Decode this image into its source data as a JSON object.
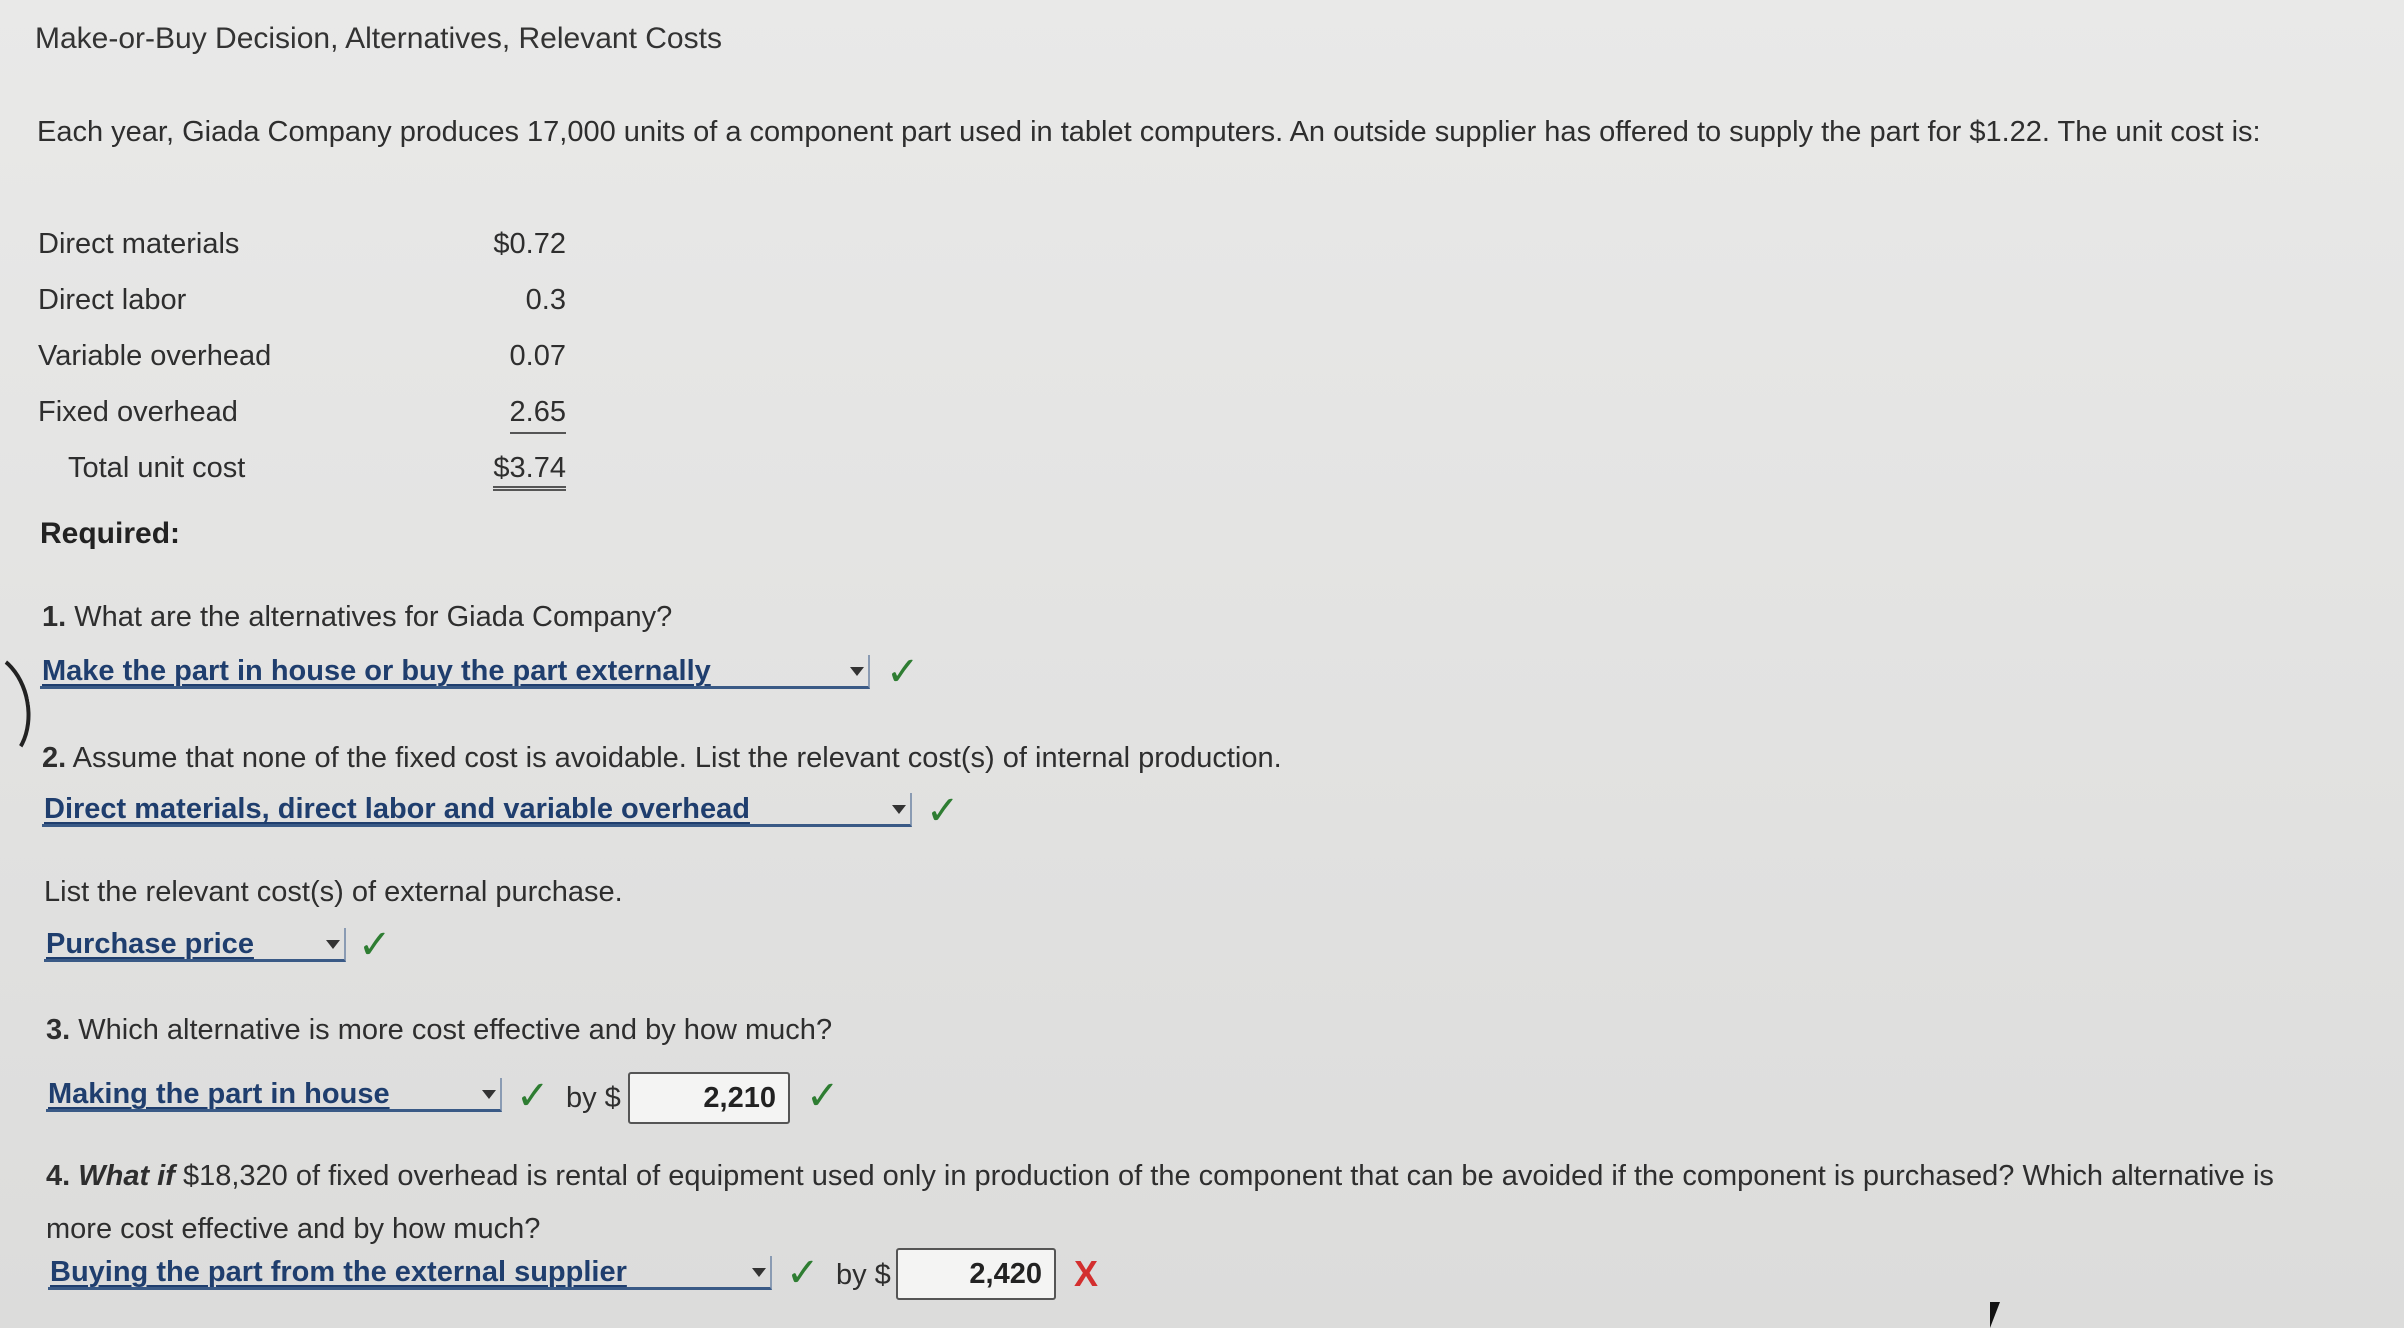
{
  "title": "Make-or-Buy Decision, Alternatives, Relevant Costs",
  "intro": "Each year, Giada Company produces 17,000 units of a component part used in tablet computers. An outside supplier has offered to supply the part for $1.22. The unit cost is:",
  "costs": [
    {
      "label": "Direct materials",
      "value": "$0.72"
    },
    {
      "label": "Direct labor",
      "value": "0.3"
    },
    {
      "label": "Variable overhead",
      "value": "0.07"
    },
    {
      "label": "Fixed overhead",
      "value": "2.65"
    },
    {
      "label": "Total unit cost",
      "value": "$3.74"
    }
  ],
  "required": "Required:",
  "q1": {
    "num": "1.",
    "text": "What are the alternatives for Giada Company?",
    "answer": "Make the part in house or buy the part externally",
    "status": "correct"
  },
  "q2": {
    "num": "2.",
    "text": "Assume that none of the fixed cost is avoidable. List the relevant cost(s) of internal production.",
    "answer": "Direct materials, direct labor and variable overhead",
    "status": "correct",
    "sub_text": "List the relevant cost(s) of external purchase.",
    "sub_answer": "Purchase price",
    "sub_status": "correct"
  },
  "q3": {
    "num": "3.",
    "text": "Which alternative is more cost effective and by how much?",
    "answer": "Making the part in house",
    "status": "correct",
    "by_label": "by $",
    "amount": "2,210",
    "amount_status": "correct"
  },
  "q4": {
    "num": "4.",
    "what_if": "What if",
    "text": "$18,320 of fixed overhead is rental of equipment used only in production of the component that can be avoided if the component is purchased? Which alternative is more cost effective and by how much?",
    "answer": "Buying the part from the external supplier",
    "status": "correct",
    "by_label": "by $",
    "amount": "2,420",
    "amount_status": "incorrect"
  },
  "marks": {
    "check": "✓",
    "cross": "X"
  },
  "colors": {
    "answer": "#1f3e6e",
    "correct": "#2e7d32",
    "incorrect": "#d32f2f"
  }
}
